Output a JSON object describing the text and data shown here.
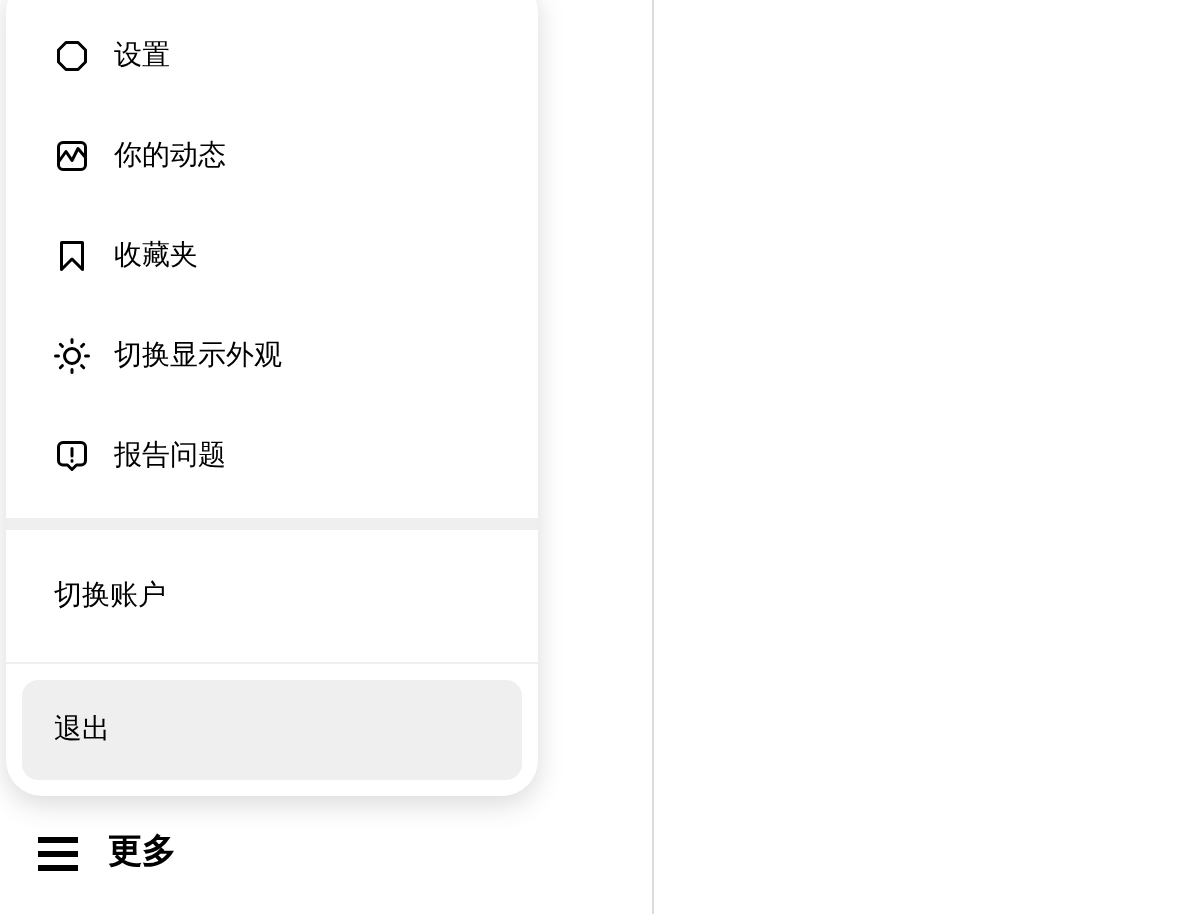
{
  "menu": {
    "items": [
      {
        "label": "设置"
      },
      {
        "label": "你的动态"
      },
      {
        "label": "收藏夹"
      },
      {
        "label": "切换显示外观"
      },
      {
        "label": "报告问题"
      }
    ],
    "account_items": [
      {
        "label": "切换账户",
        "highlighted": false
      },
      {
        "label": "退出",
        "highlighted": true
      }
    ]
  },
  "more_button": {
    "label": "更多"
  }
}
